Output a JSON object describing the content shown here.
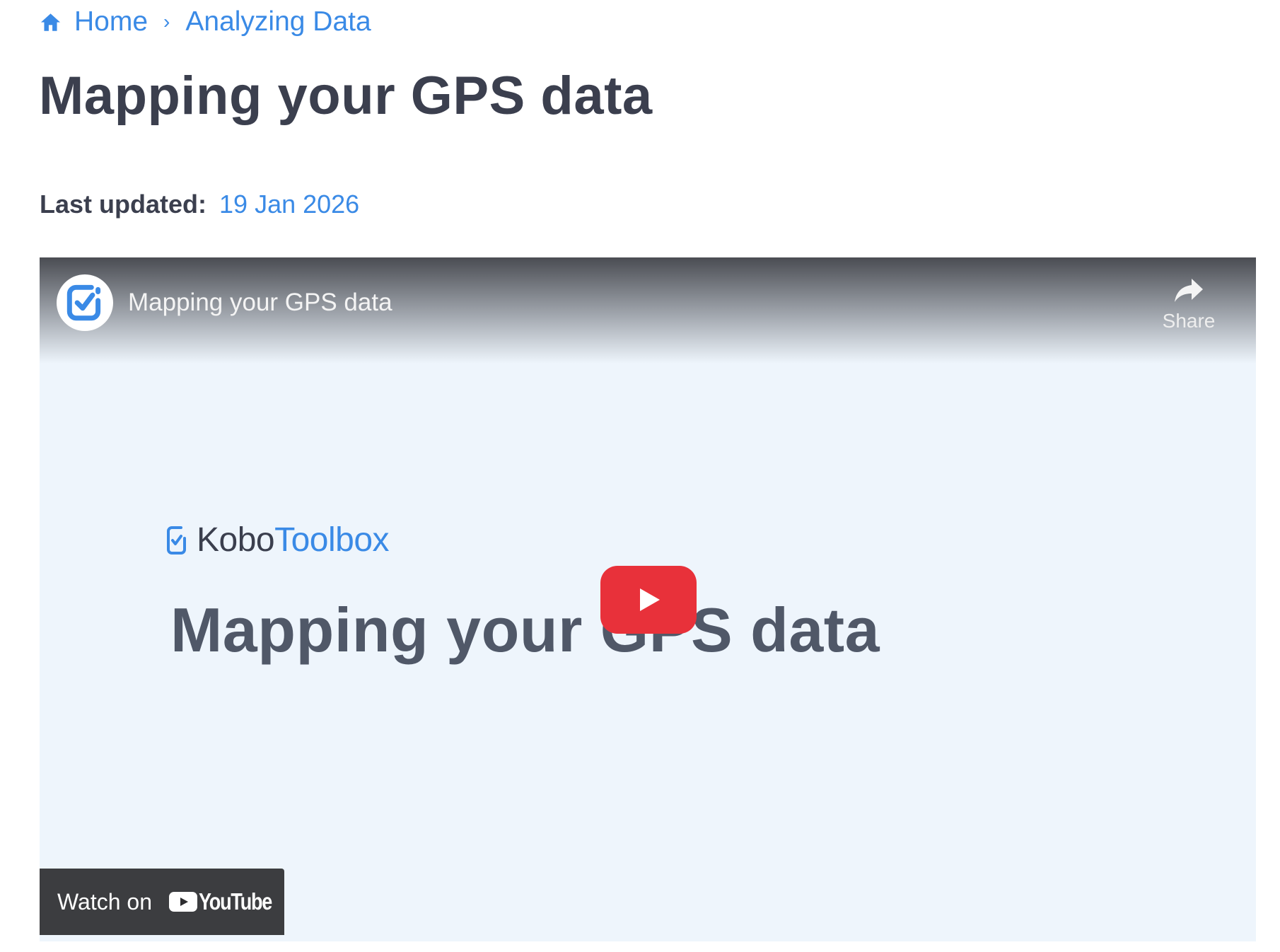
{
  "breadcrumb": {
    "home_label": "Home",
    "separator": "›",
    "current_label": "Analyzing Data"
  },
  "page": {
    "title": "Mapping your GPS data",
    "last_updated_label": "Last updated:",
    "last_updated_date": "19 Jan 2026"
  },
  "video": {
    "title": "Mapping your GPS data",
    "share_label": "Share",
    "brand_kobo": "Kobo",
    "brand_toolbox": "Toolbox",
    "thumbnail_title": "Mapping your GPS data",
    "watch_on_label": "Watch on",
    "youtube_wordmark": "YouTube"
  },
  "colors": {
    "link": "#3a8ae6",
    "text": "#3b3f4e",
    "play_red": "#e8313a",
    "video_bg": "#eef5fc"
  },
  "icons": {
    "home": "home-icon",
    "share": "share-icon",
    "play": "play-icon",
    "channel": "kobotoolbox-logo-icon",
    "youtube": "youtube-logo-icon"
  }
}
